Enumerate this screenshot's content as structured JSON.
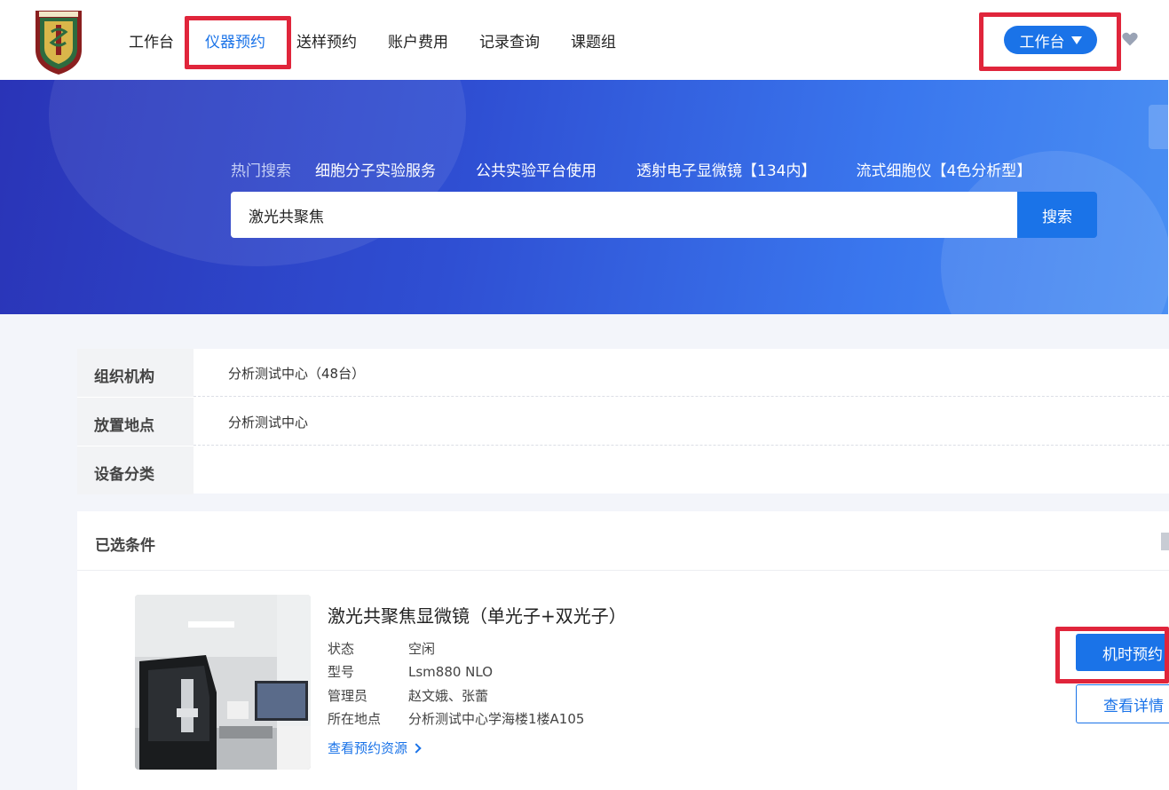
{
  "header": {
    "logo_alt": "南京医科大学",
    "nav": [
      {
        "label": "工作台"
      },
      {
        "label": "仪器预约"
      },
      {
        "label": "送样预约"
      },
      {
        "label": "账户费用"
      },
      {
        "label": "记录查询"
      },
      {
        "label": "课题组"
      }
    ],
    "active_nav": "仪器预约",
    "workspace_button": "工作台",
    "accent_color": "#1a73e8",
    "highlight_color": "#e0253b"
  },
  "banner": {
    "hot_label": "热门搜索",
    "hot_tags": [
      "细胞分子实验服务",
      "公共实验平台使用",
      "透射电子显微镜【134内】",
      "流式细胞仪【4色分析型】"
    ],
    "search_value": "激光共聚焦",
    "search_button": "搜索"
  },
  "filters": [
    {
      "label": "组织机构",
      "value": "分析测试中心（48台）"
    },
    {
      "label": "放置地点",
      "value": "分析测试中心"
    },
    {
      "label": "设备分类",
      "value": ""
    }
  ],
  "results": {
    "selected_title": "已选条件",
    "instrument": {
      "title": "激光共聚焦显微镜（单光子+双光子）",
      "fields": [
        {
          "key": "状态",
          "value": "空闲"
        },
        {
          "key": "型号",
          "value": "Lsm880 NLO"
        },
        {
          "key": "管理员",
          "value": "赵文娥、张蕾"
        },
        {
          "key": "所在地点",
          "value": "分析测试中心学海楼1楼A105"
        }
      ],
      "resource_link": "查看预约资源",
      "book_button": "机时预约",
      "detail_button": "查看详情"
    }
  }
}
